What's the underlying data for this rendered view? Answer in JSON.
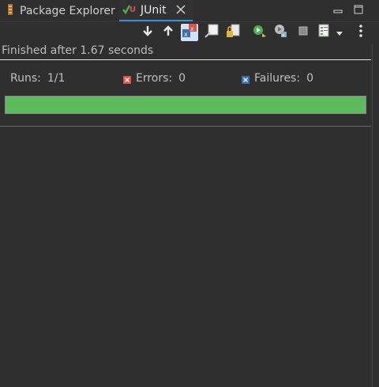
{
  "tabs": {
    "package_explorer": "Package Explorer",
    "junit": "JUnit"
  },
  "status": {
    "finished": "Finished after 1.67 seconds"
  },
  "counts": {
    "runs_label": "Runs:",
    "runs_value": "1/1",
    "errors_label": "Errors:",
    "errors_value": "0",
    "failures_label": "Failures:",
    "failures_value": "0"
  },
  "progress": {
    "fraction": 1.0,
    "color": "#5cba5b"
  },
  "icons": {
    "toolbar": [
      "arrow-down-icon",
      "arrow-up-icon",
      "show-failures-only-icon",
      "scroll-lock-icon",
      "lock-icon",
      "rerun-icon",
      "rerun-failures-first-icon",
      "stop-icon",
      "history-icon",
      "dropdown-caret-icon",
      "kebab-menu-icon"
    ]
  },
  "colors": {
    "accent": "#3d8fd3",
    "error": "#d9534f",
    "failure": "#3b6db3"
  }
}
